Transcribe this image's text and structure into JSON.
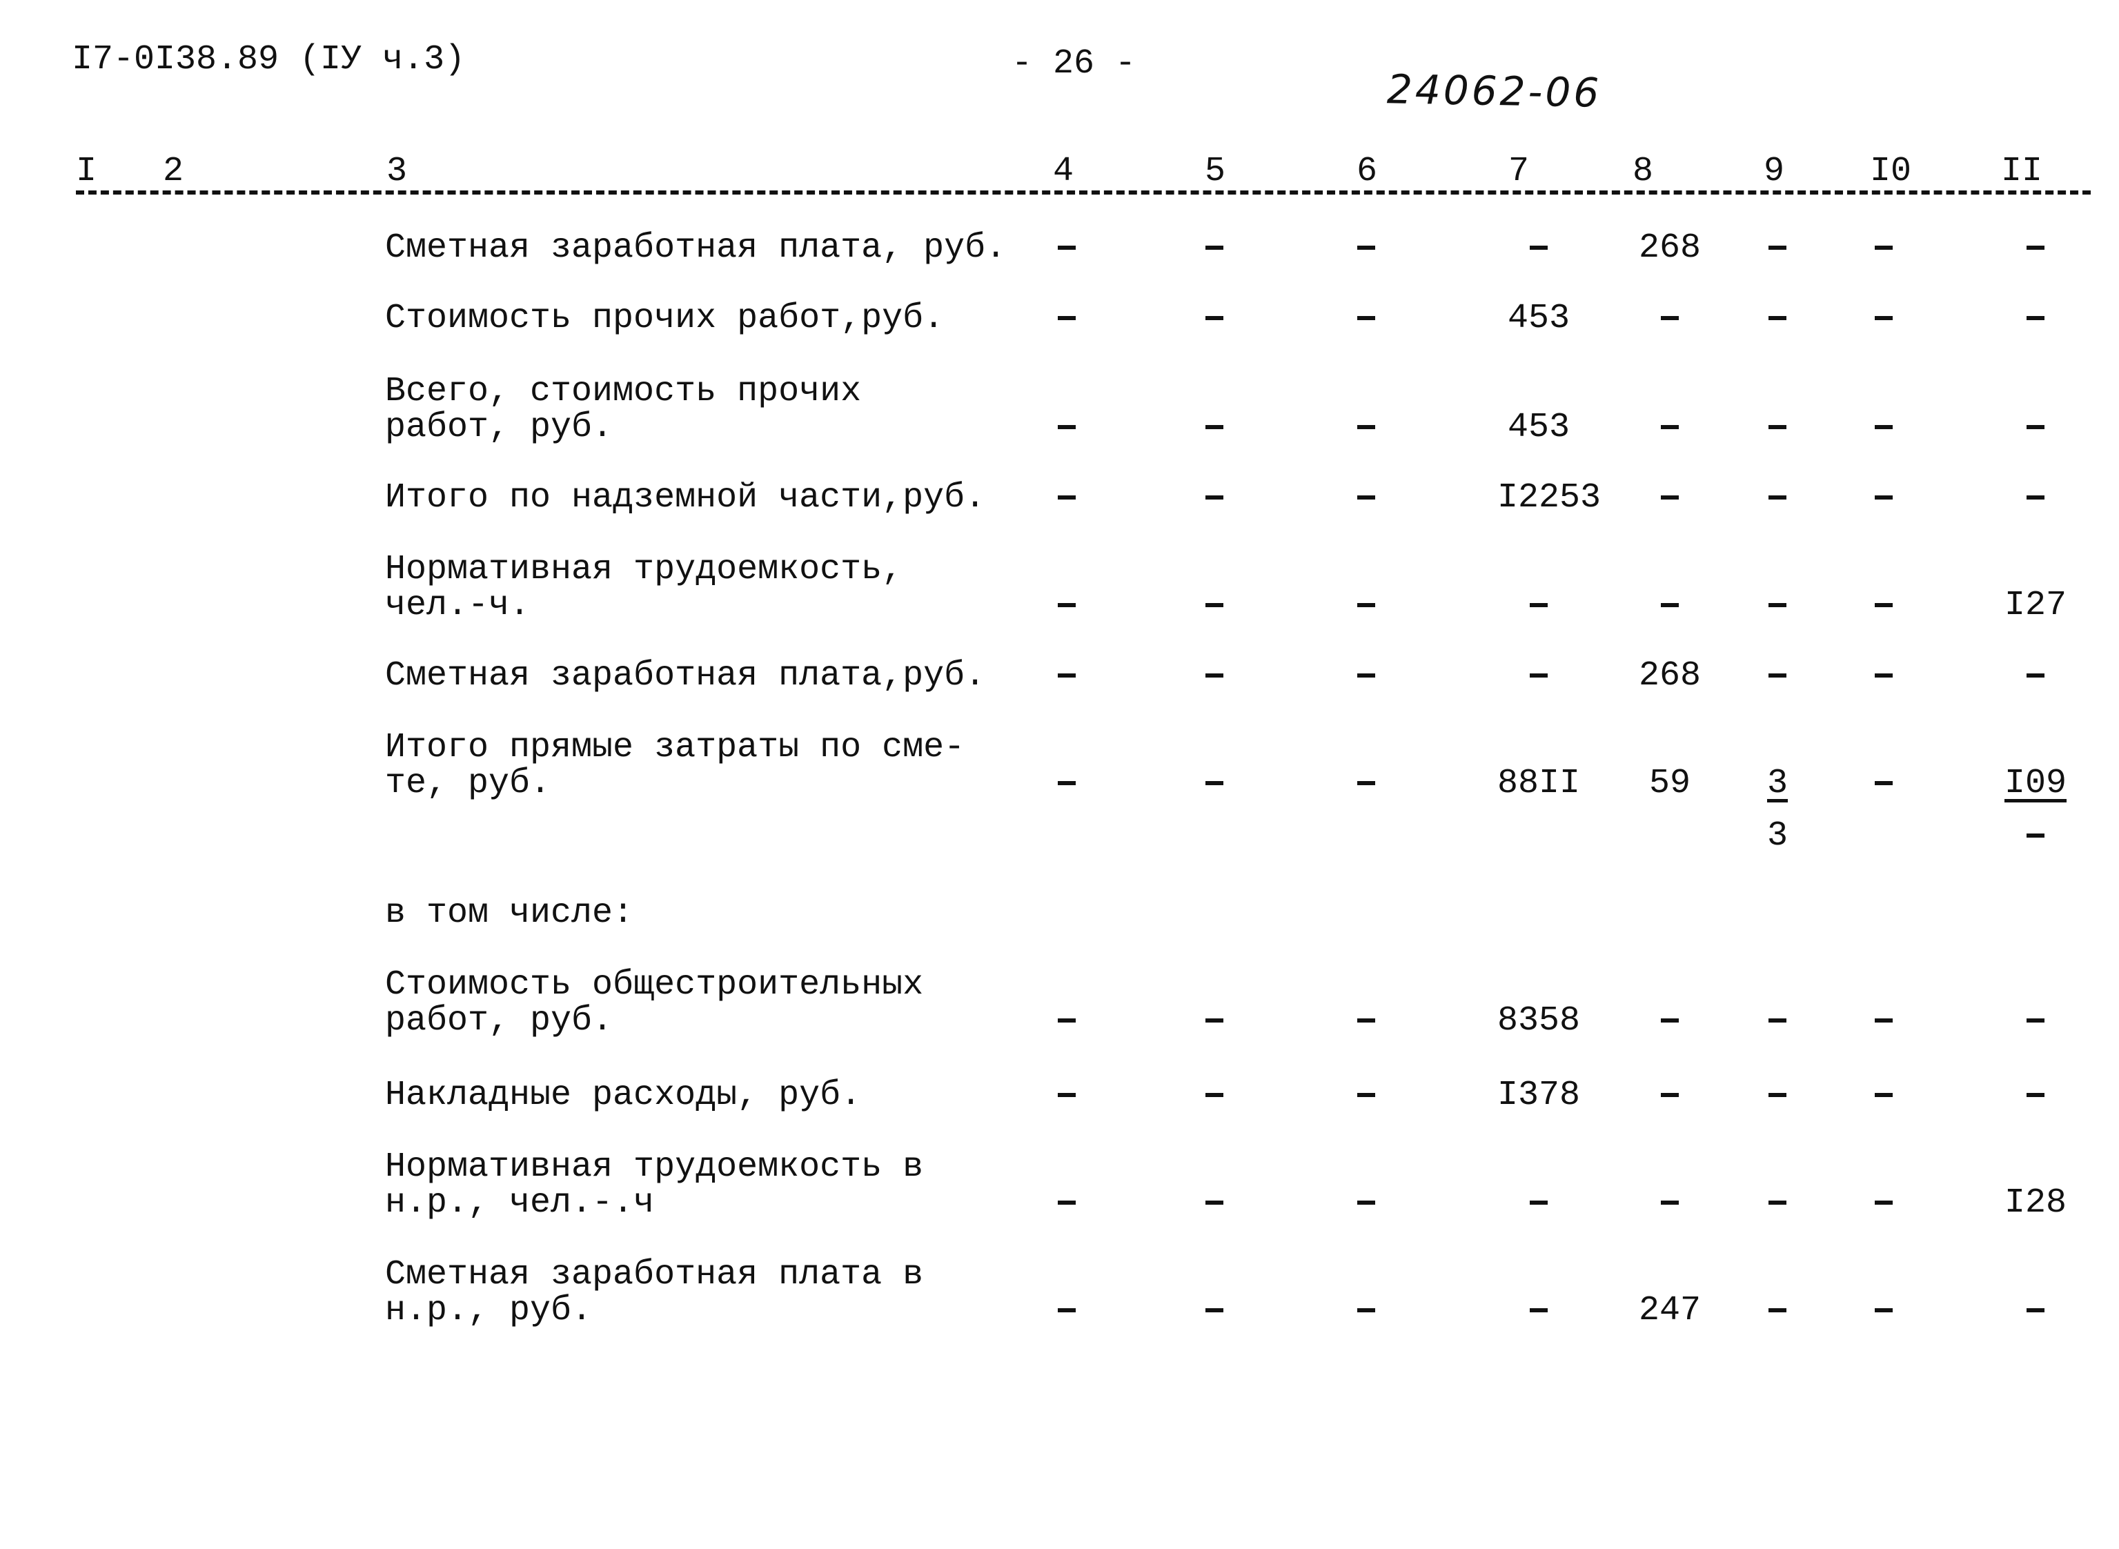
{
  "header": {
    "doc_code": "I7-0I38.89 (IУ ч.3)",
    "page_number": "- 26 -",
    "handwritten_number": "24062-06"
  },
  "columns": [
    "I",
    "2",
    "3",
    "4",
    "5",
    "6",
    "7",
    "8",
    "9",
    "I0",
    "II"
  ],
  "rows": [
    {
      "label": [
        "Сметная заработная плата, руб."
      ],
      "values": [
        "-",
        "-",
        "-",
        "-",
        "268",
        "-",
        "-",
        "-"
      ]
    },
    {
      "label": [
        "Стоимость прочих работ,руб."
      ],
      "values": [
        "-",
        "-",
        "-",
        "453",
        "-",
        "-",
        "-",
        "-"
      ]
    },
    {
      "label": [
        "Всего, стоимость прочих",
        "работ, руб."
      ],
      "values": [
        "-",
        "-",
        "-",
        "453",
        "-",
        "-",
        "-",
        "-"
      ]
    },
    {
      "label": [
        "Итого по надземной части,руб."
      ],
      "values": [
        "-",
        "-",
        "-",
        "I2253",
        "-",
        "-",
        "-",
        "-"
      ]
    },
    {
      "label": [
        "Нормативная трудоемкость,",
        "чел.-ч."
      ],
      "values": [
        "-",
        "-",
        "-",
        "-",
        "-",
        "-",
        "-",
        "I27"
      ]
    },
    {
      "label": [
        "Сметная заработная плата,руб."
      ],
      "values": [
        "-",
        "-",
        "-",
        "-",
        "268",
        "-",
        "-",
        "-"
      ]
    },
    {
      "label": [
        "Итого прямые затраты по сме-",
        "те, руб."
      ],
      "values": [
        "-",
        "-",
        "-",
        "88II",
        "59",
        "3",
        "-",
        "I09"
      ],
      "sub_values": [
        "",
        "",
        "",
        "",
        "",
        "3",
        "",
        "-"
      ]
    },
    {
      "label": [
        "в том числе:"
      ],
      "values": []
    },
    {
      "label": [
        "Стоимость общестроительных",
        "работ, руб."
      ],
      "values": [
        "-",
        "-",
        "-",
        "8358",
        "-",
        "-",
        "-",
        "-"
      ]
    },
    {
      "label": [
        "Накладные расходы, руб."
      ],
      "values": [
        "-",
        "-",
        "-",
        "I378",
        "-",
        "-",
        "-",
        "-"
      ]
    },
    {
      "label": [
        "Нормативная трудоемкость в",
        "н.р., чел.-.ч"
      ],
      "values": [
        "-",
        "-",
        "-",
        "-",
        "-",
        "-",
        "-",
        "I28"
      ]
    },
    {
      "label": [
        "Сметная заработная плата в",
        "н.р., руб."
      ],
      "values": [
        "-",
        "-",
        "-",
        "-",
        "247",
        "-",
        "-",
        "-"
      ]
    }
  ]
}
